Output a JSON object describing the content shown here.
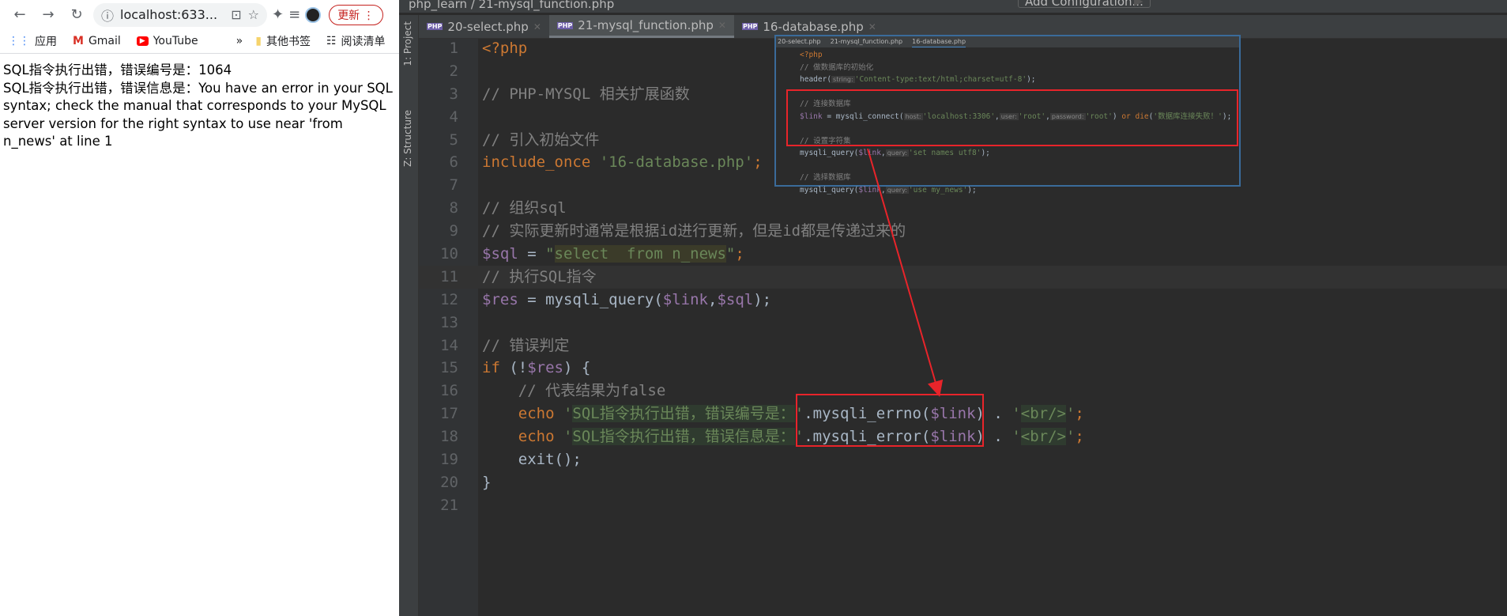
{
  "browser": {
    "url": "localhost:633...",
    "update_label": "更新",
    "bookmarks": [
      {
        "label": "应用",
        "icon": "apps-grid-icon"
      },
      {
        "label": "Gmail",
        "icon": "gmail-icon"
      },
      {
        "label": "YouTube",
        "icon": "youtube-icon"
      }
    ],
    "more": "»",
    "other_bookmarks": "其他书签",
    "reading_list": "阅读清单",
    "output": [
      "SQL指令执行出错，错误编号是：1064",
      "SQL指令执行出错，错误信息是：You have an error in your SQL syntax; check the manual that corresponds to your MySQL server version for the right syntax to use near 'from n_news' at line 1"
    ]
  },
  "ide": {
    "breadcrumb": "php_learn  /  21-mysql_function.php",
    "add_config": "Add Configuration...",
    "side": {
      "project": "1: Project",
      "structure": "Z: Structure"
    },
    "tabs": [
      {
        "label": "20-select.php",
        "active": false
      },
      {
        "label": "21-mysql_function.php",
        "active": true
      },
      {
        "label": "16-database.php",
        "active": false
      }
    ],
    "current_line": 11,
    "lines": [
      [
        [
          "<?php",
          "kw"
        ]
      ],
      [],
      [
        [
          "// PHP-MYSQL 相关扩展函数",
          "cm"
        ]
      ],
      [],
      [
        [
          "// 引入初始文件",
          "cm"
        ]
      ],
      [
        [
          "include_once ",
          "kw"
        ],
        [
          "'16-database.php'",
          "str"
        ],
        [
          ";",
          "kw"
        ]
      ],
      [],
      [
        [
          "// 组织sql",
          "cm"
        ]
      ],
      [
        [
          "// 实际更新时通常是根据id进行更新，但是id都是传递过来的",
          "cm"
        ]
      ],
      [
        [
          "$sql",
          "var"
        ],
        [
          " = ",
          ""
        ],
        [
          "\"",
          "str"
        ],
        [
          "select  from n_news",
          "str hl"
        ],
        [
          "\"",
          "str"
        ],
        [
          ";",
          "kw"
        ]
      ],
      [
        [
          "// 执行SQL指令",
          "cm"
        ]
      ],
      [
        [
          "$res",
          "var"
        ],
        [
          " = mysqli_query(",
          ""
        ],
        [
          "$link",
          "var"
        ],
        [
          ",",
          ""
        ],
        [
          "$sql",
          "var"
        ],
        [
          ");",
          ""
        ]
      ],
      [],
      [
        [
          "// 错误判定",
          "cm"
        ]
      ],
      [
        [
          "if",
          "kw"
        ],
        [
          " (!",
          ""
        ],
        [
          "$res",
          "var"
        ],
        [
          ") {",
          ""
        ]
      ],
      [
        [
          "    // 代表结果为false",
          "cm"
        ]
      ],
      [
        [
          "    echo ",
          "kw"
        ],
        [
          "'",
          "str"
        ],
        [
          "SQL指令执行出错，错误编号是：",
          "str hs"
        ],
        [
          "'",
          "str"
        ],
        [
          ".mysqli_errno(",
          ""
        ],
        [
          "$link",
          "var"
        ],
        [
          ") . ",
          ""
        ],
        [
          "'",
          "str"
        ],
        [
          "<br/>",
          "str hs"
        ],
        [
          "'",
          "str"
        ],
        [
          ";",
          "kw"
        ]
      ],
      [
        [
          "    echo ",
          "kw"
        ],
        [
          "'",
          "str"
        ],
        [
          "SQL指令执行出错，错误信息是：",
          "str hs"
        ],
        [
          "'",
          "str"
        ],
        [
          ".mysqli_error(",
          ""
        ],
        [
          "$link",
          "var"
        ],
        [
          ") . ",
          ""
        ],
        [
          "'",
          "str"
        ],
        [
          "<br/>",
          "str hs"
        ],
        [
          "'",
          "str"
        ],
        [
          ";",
          "kw"
        ]
      ],
      [
        [
          "    exit();",
          ""
        ]
      ],
      [
        [
          "}",
          ""
        ]
      ],
      []
    ],
    "inset": {
      "tabs": [
        "20-select.php",
        "21-mysql_function.php",
        "16-database.php"
      ],
      "lines": [
        [
          [
            "<?php",
            "kw"
          ]
        ],
        [
          [
            "// 做数据库的初始化",
            "cm"
          ]
        ],
        [
          [
            "header(",
            ""
          ],
          [
            "string:",
            "hint"
          ],
          [
            "'Content-type:text/html;charset=utf-8'",
            "str"
          ],
          [
            ");",
            ""
          ]
        ],
        [],
        [
          [
            "// 连接数据库",
            "cm"
          ]
        ],
        [
          [
            "$link",
            "var"
          ],
          [
            " = mysqli_connect(",
            ""
          ],
          [
            "host:",
            "hint"
          ],
          [
            "'localhost:3306'",
            "str"
          ],
          [
            ",",
            ""
          ],
          [
            "user:",
            "hint"
          ],
          [
            "'root'",
            "str"
          ],
          [
            ",",
            ""
          ],
          [
            "password:",
            "hint"
          ],
          [
            "'root'",
            "str"
          ],
          [
            ") ",
            ""
          ],
          [
            "or die",
            "kw"
          ],
          [
            "(",
            ""
          ],
          [
            "'数据库连接失败！'",
            "str"
          ],
          [
            ");",
            ""
          ]
        ],
        [],
        [
          [
            "// 设置字符集",
            "cm"
          ]
        ],
        [
          [
            "mysqli_query(",
            ""
          ],
          [
            "$link",
            "var"
          ],
          [
            ",",
            ""
          ],
          [
            "query:",
            "hint"
          ],
          [
            "'set names utf8'",
            "str"
          ],
          [
            ");",
            ""
          ]
        ],
        [],
        [
          [
            "// 选择数据库",
            "cm"
          ]
        ],
        [
          [
            "mysqli_query(",
            ""
          ],
          [
            "$link",
            "var"
          ],
          [
            ",",
            ""
          ],
          [
            "query:",
            "hint"
          ],
          [
            "'use my_news'",
            "str"
          ],
          [
            ");",
            ""
          ]
        ]
      ]
    }
  },
  "colors": {
    "annotation": "#e8242a",
    "keyword": "#cc7832",
    "string": "#6a8759",
    "variable": "#9876aa",
    "comment": "#808080"
  }
}
